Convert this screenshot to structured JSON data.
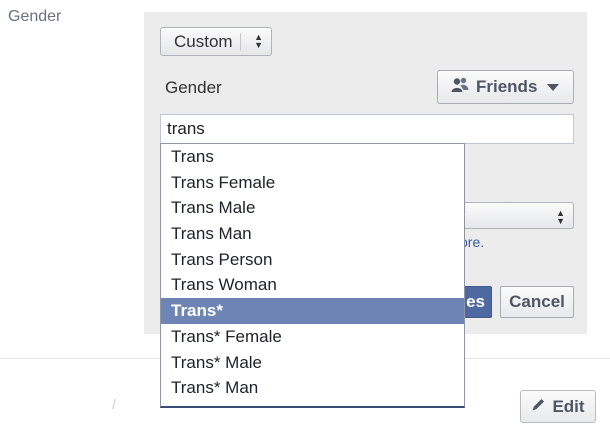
{
  "left_column": {
    "label": "Gender"
  },
  "gender_select": {
    "value": "Custom"
  },
  "custom_field": {
    "label": "Gender",
    "value": "trans"
  },
  "privacy": {
    "label": "Friends"
  },
  "partial_link": "ore.",
  "actions": {
    "save_partial": "es",
    "cancel": "Cancel"
  },
  "faint_mark": "/",
  "edit_button": {
    "label": "Edit"
  },
  "suggestions": [
    "Trans",
    "Trans Female",
    "Trans Male",
    "Trans Man",
    "Trans Person",
    "Trans Woman",
    "Trans*",
    "Trans* Female",
    "Trans* Male",
    "Trans* Man"
  ],
  "selected_suggestion": "Trans*",
  "colors": {
    "highlight": "#6d84b4",
    "primary_button": "#4e69a2",
    "link": "#3b5998"
  }
}
